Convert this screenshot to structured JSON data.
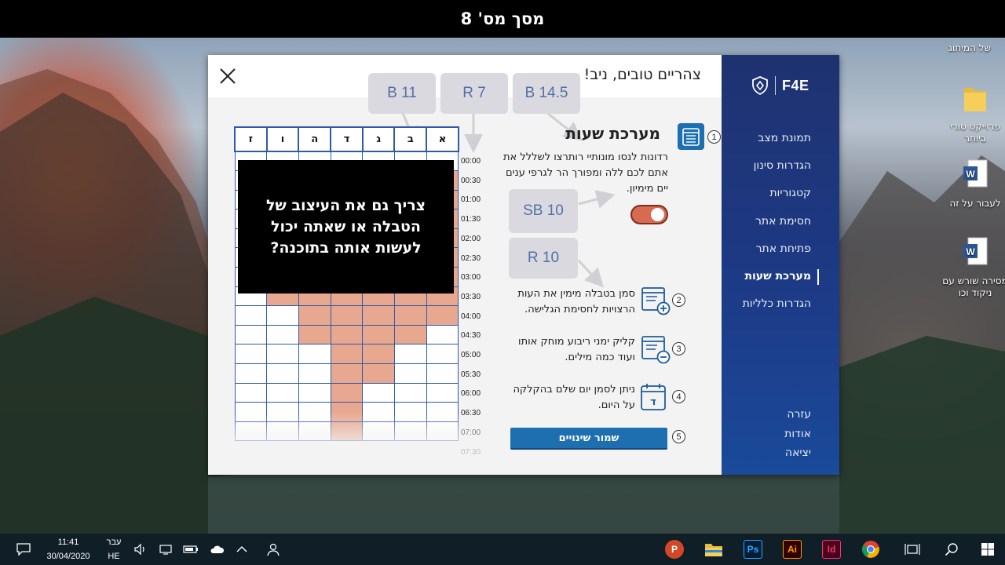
{
  "top_title": "מסך מס' 8",
  "desktop": {
    "icons": [
      {
        "name": "folder-desktop",
        "label": "של המיתוג"
      },
      {
        "name": "folder-project",
        "label": "פרוייקט טורי ביותר"
      },
      {
        "name": "word-doc-1",
        "label": "לעבור על זה"
      },
      {
        "name": "word-doc-2",
        "label": "מסירה שורש עם ניקוד וכו"
      }
    ]
  },
  "dialog": {
    "greeting": "צהריים טובים, ניב!",
    "sidebar": {
      "brand": "F4E",
      "nav": [
        "תמונת מצב",
        "הגדרות סינון",
        "קטגוריות",
        "חסימת אתר",
        "פתיחת אתר",
        "מערכת שעות",
        "הגדרות כלליות"
      ],
      "active": "מערכת שעות",
      "bottom": [
        "עזרה",
        "אודות",
        "יציאה"
      ]
    },
    "callouts": {
      "b145": "B 14.5",
      "r7": "R 7",
      "b11": "B 11",
      "sb10": "SB 10",
      "r10": "R 10"
    },
    "section_title": "מערכת שעות",
    "steps": {
      "n1": "1",
      "n2": "2",
      "n3": "3",
      "n4": "4",
      "n5": "5",
      "d1": "רדונות לנסו מונותיי רותרצו לשללל את אתם לכם ללה ומפורך הר לגרפי ענים יים מימיון.",
      "d2": "סמן בטבלה מימין את העות הרצויות לחסימת הגלישה.",
      "d3": "קליק ימני ריבוע מוחק אותו ועוד כמה מילים.",
      "d4": "ניתן לסמן יום שלם בהקלקה על היום."
    },
    "toggle_on": true,
    "save_label": "שמור שינויים",
    "schedule": {
      "days": [
        "ז",
        "ו",
        "ה",
        "ד",
        "ג",
        "ב",
        "א"
      ],
      "times": [
        "00:00",
        "00:30",
        "01:00",
        "01:30",
        "02:00",
        "02:30",
        "03:00",
        "03:30",
        "04:00",
        "04:30",
        "05:00",
        "05:30",
        "06:00",
        "06:30",
        "07:00",
        "07:30"
      ]
    },
    "overlay_note": "צריך גם את העיצוב של הטבלה או שאתה יכול לעשות אותה בתוכנה?"
  },
  "taskbar": {
    "time": "11:41",
    "date": "30/04/2020",
    "lang_top": "עבר",
    "lang_bottom": "HE",
    "apps": [
      "powerpoint",
      "file-explorer",
      "photoshop",
      "illustrator",
      "indesign",
      "chrome",
      "task-view",
      "search",
      "start"
    ]
  },
  "colors": {
    "sidebar": "#1e3270",
    "cell_selected": "#e8a890",
    "table_border": "#2e5aa8",
    "save_button": "#1d6fb0",
    "toggle": "#d96a52"
  }
}
